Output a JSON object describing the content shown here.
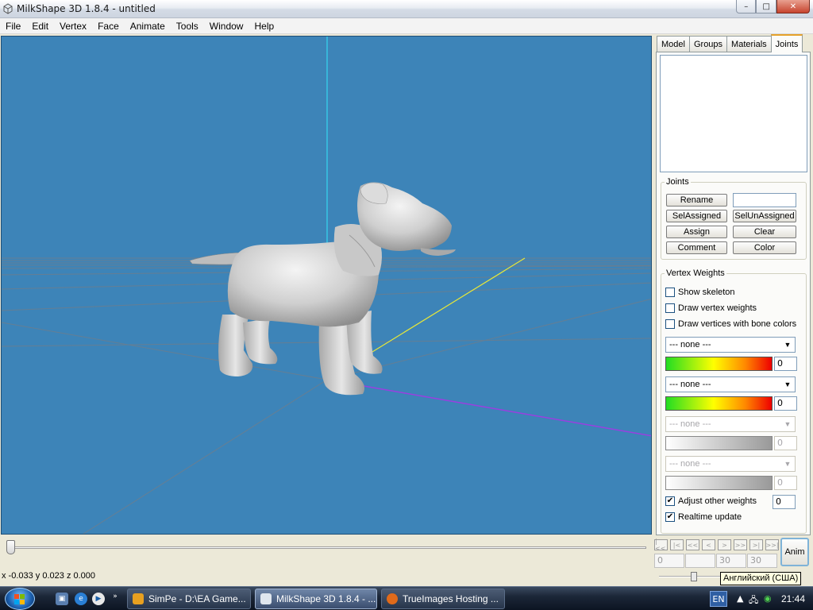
{
  "window": {
    "title": "MilkShape 3D 1.8.4 - untitled",
    "min_glyph": "–",
    "max_glyph": "□",
    "close_glyph": "✕"
  },
  "menu": [
    "File",
    "Edit",
    "Vertex",
    "Face",
    "Animate",
    "Tools",
    "Window",
    "Help"
  ],
  "tabs": [
    {
      "label": "Model",
      "active": false
    },
    {
      "label": "Groups",
      "active": false
    },
    {
      "label": "Materials",
      "active": false
    },
    {
      "label": "Joints",
      "active": true
    }
  ],
  "joints": {
    "legend": "Joints",
    "rename": "Rename",
    "name_value": "",
    "sel_assigned": "SelAssigned",
    "sel_unassigned": "SelUnAssigned",
    "assign": "Assign",
    "clear": "Clear",
    "comment": "Comment",
    "color": "Color"
  },
  "vertex_weights": {
    "legend": "Vertex Weights",
    "show_skeleton": {
      "label": "Show skeleton",
      "checked": false
    },
    "draw_vertex_weights": {
      "label": "Draw vertex weights",
      "checked": false
    },
    "draw_bone_colors": {
      "label": "Draw vertices with bone colors",
      "checked": false
    },
    "slots": [
      {
        "bone": "--- none ---",
        "weight": "0",
        "enabled": true
      },
      {
        "bone": "--- none ---",
        "weight": "0",
        "enabled": true
      },
      {
        "bone": "--- none ---",
        "weight": "0",
        "enabled": false
      },
      {
        "bone": "--- none ---",
        "weight": "0",
        "enabled": false
      }
    ],
    "adjust_other": {
      "label": "Adjust other weights",
      "checked": true,
      "value": "0"
    },
    "realtime": {
      "label": "Realtime update",
      "checked": true
    }
  },
  "animation": {
    "controls": [
      "|<<",
      "|<",
      "<<",
      "<",
      ">",
      ">>",
      ">|",
      ">>|"
    ],
    "frames": [
      "0",
      "",
      "30",
      "30"
    ],
    "anim_label": "Anim"
  },
  "status": {
    "coords": "x -0.033 y 0.023 z 0.000",
    "tooltip": "Английский (США)"
  },
  "taskbar": {
    "more": "»",
    "items": [
      {
        "label": "SimPe - D:\\EA Game...",
        "active": false,
        "icon_color": "#e8a020"
      },
      {
        "label": "MilkShape 3D 1.8.4 - ...",
        "active": true,
        "icon_color": "#dfe6ee"
      },
      {
        "label": "TrueImages Hosting ...",
        "active": false,
        "icon_color": "#e06a1a"
      }
    ],
    "lang": "EN",
    "clock": "21:44"
  },
  "colors": {
    "viewport": "#3d84b8",
    "axis_y": "#35d6f0",
    "axis_x": "#9a3fe0",
    "axis_z": "#e8e838"
  }
}
